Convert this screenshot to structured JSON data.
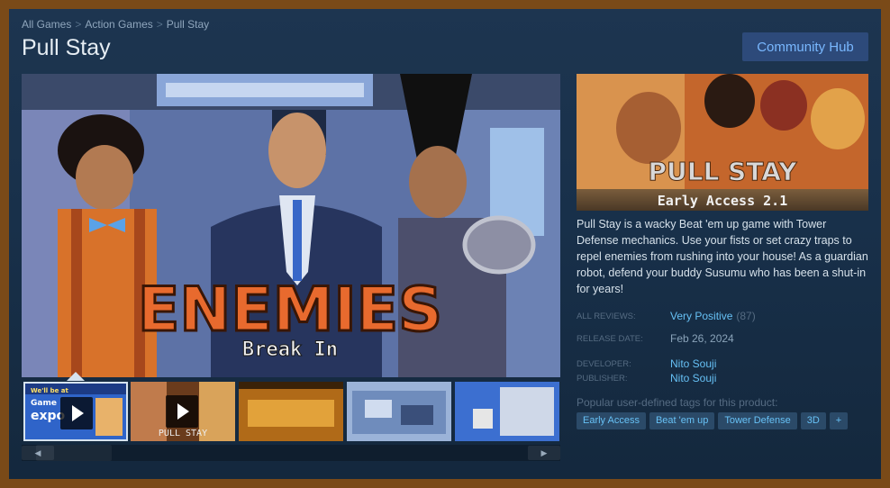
{
  "breadcrumb": {
    "items": [
      "All Games",
      "Action Games",
      "Pull Stay"
    ],
    "sep": ">"
  },
  "title": "Pull Stay",
  "community_hub_label": "Community Hub",
  "main_media": {
    "headline": "ENEMIES",
    "subline": "Break In"
  },
  "thumbs": {
    "t1_title_lines": [
      "We'll be at",
      "Game",
      "expo"
    ],
    "t2_logo": "PULL STAY"
  },
  "scroll": {
    "left": "◀",
    "right": "▶"
  },
  "capsule": {
    "logo": "PULL STAY",
    "banner": "Early Access 2.1"
  },
  "description": "Pull Stay is a wacky Beat 'em up game with Tower Defense mechanics. Use your fists or set crazy traps to repel enemies from rushing into your house! As a guardian robot, defend your buddy Susumu who has been a shut-in for years!",
  "reviews": {
    "label": "ALL REVIEWS:",
    "value": "Very Positive",
    "count": "(87)"
  },
  "release": {
    "label": "RELEASE DATE:",
    "value": "Feb 26, 2024"
  },
  "developer": {
    "label": "DEVELOPER:",
    "value": "Nito Souji"
  },
  "publisher": {
    "label": "PUBLISHER:",
    "value": "Nito Souji"
  },
  "tags_label": "Popular user-defined tags for this product:",
  "tags": [
    "Early Access",
    "Beat 'em up",
    "Tower Defense",
    "3D",
    "+"
  ],
  "colors": {
    "accent": "#66c0f4",
    "hub_bg": "#2d4a7a",
    "frame_outer": "#7a4a18"
  }
}
